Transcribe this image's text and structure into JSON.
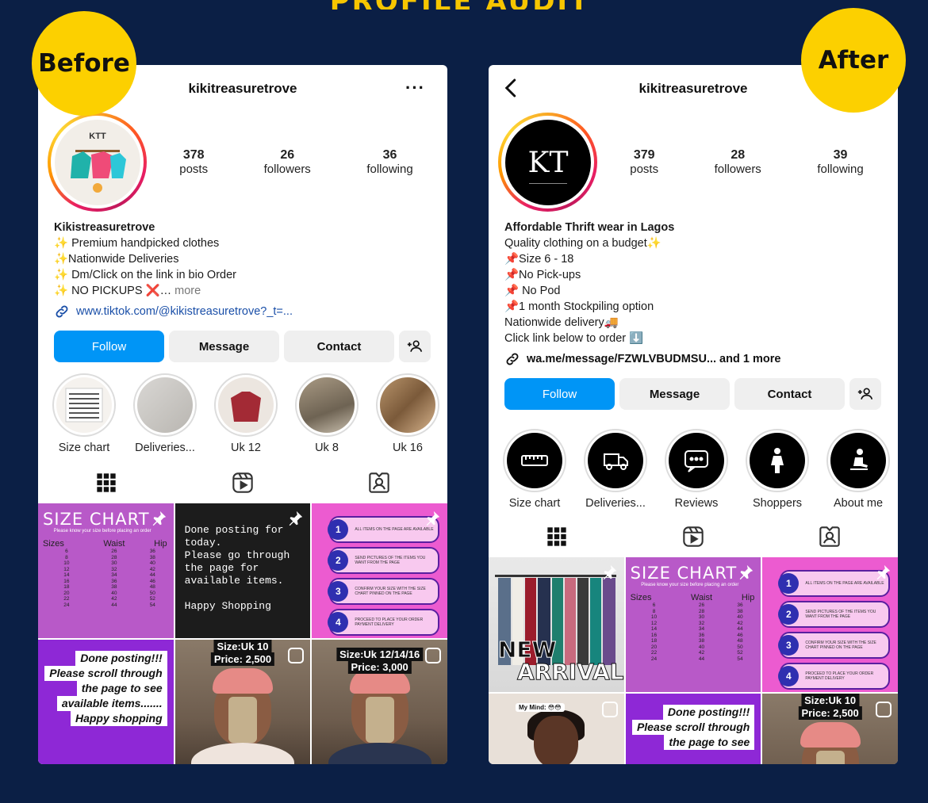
{
  "badges": {
    "before": "Before",
    "after": "After"
  },
  "before": {
    "username": "kikitreasuretrove",
    "more": "···",
    "stats": [
      {
        "num": "378",
        "label": "posts"
      },
      {
        "num": "26",
        "label": "followers"
      },
      {
        "num": "36",
        "label": "following"
      }
    ],
    "bio_name": "Kikistreasuretrove",
    "bio_lines": [
      "✨ Premium handpicked clothes",
      "✨Nationwide Deliveries",
      "✨ Dm/Click on the link in bio Order",
      "✨ NO PICKUPS ❌…"
    ],
    "bio_more": "more",
    "link": "www.tiktok.com/@kikistreasuretrove?_t=...",
    "buttons": {
      "follow": "Follow",
      "message": "Message",
      "contact": "Contact"
    },
    "highlights": [
      "Size chart",
      "Deliveries...",
      "Uk 12",
      "Uk 8",
      "Uk 16"
    ],
    "grid": {
      "size_chart_title": "SIZE CHART",
      "size_chart_sub": "Please know your size before placing an order",
      "size_headers": [
        "Sizes",
        "Waist",
        "Hip"
      ],
      "size_rows": [
        [
          "6",
          "26",
          "36"
        ],
        [
          "8",
          "28",
          "38"
        ],
        [
          "10",
          "30",
          "40"
        ],
        [
          "12",
          "32",
          "42"
        ],
        [
          "14",
          "34",
          "44"
        ],
        [
          "16",
          "36",
          "46"
        ],
        [
          "18",
          "38",
          "48"
        ],
        [
          "20",
          "40",
          "50"
        ],
        [
          "22",
          "42",
          "52"
        ],
        [
          "24",
          "44",
          "54"
        ]
      ],
      "done_text": "Done posting for today.\nPlease go through the page for available items.\n\nHappy Shopping",
      "steps": [
        "ALL ITEMS ON THE PAGE ARE AVAILABLE",
        "SEND PICTURES OF THE ITEMS YOU WANT FROM THE PAGE",
        "CONFIRM YOUR SIZE WITH THE SIZE CHART PINNED ON THE PAGE",
        "PROCEED TO PLACE YOUR ORDER PAYMENT DELIVERY"
      ],
      "done_posting": [
        "Done posting!!!",
        "Please scroll through",
        "the page to see",
        "available items.......",
        "Happy shopping"
      ],
      "price1": [
        "Size:Uk 10",
        "Price: 2,500"
      ],
      "price2": [
        "Size:Uk 12/14/16",
        "Price: 3,000"
      ]
    }
  },
  "after": {
    "username": "kikitreasuretrove",
    "stats": [
      {
        "num": "379",
        "label": "posts"
      },
      {
        "num": "28",
        "label": "followers"
      },
      {
        "num": "39",
        "label": "following"
      }
    ],
    "bio_name": "Affordable Thrift wear in Lagos",
    "bio_lines": [
      "Quality clothing on a budget✨",
      "📌Size 6 - 18",
      "📌No Pick-ups",
      "📌 No Pod",
      "📌1 month Stockpiling option",
      "Nationwide delivery🚚",
      "Click link below to order ⬇️"
    ],
    "link": "wa.me/message/FZWLVBUDMSU... and 1 more",
    "logo_text": "KT",
    "buttons": {
      "follow": "Follow",
      "message": "Message",
      "contact": "Contact"
    },
    "highlights": [
      "Size chart",
      "Deliveries...",
      "Reviews",
      "Shoppers",
      "About me"
    ],
    "grid": {
      "new_arrival": [
        "NEW",
        "ARRIVAL"
      ],
      "my_mind": "My Mind: 😳😳",
      "done_posting": [
        "Done posting!!!",
        "Please scroll through",
        "the page to see"
      ],
      "price1": [
        "Size:Uk 10",
        "Price: 2,500"
      ]
    }
  },
  "colors": {
    "background": "#0b1f45",
    "badge": "#fcd000",
    "follow": "#0095f6"
  }
}
